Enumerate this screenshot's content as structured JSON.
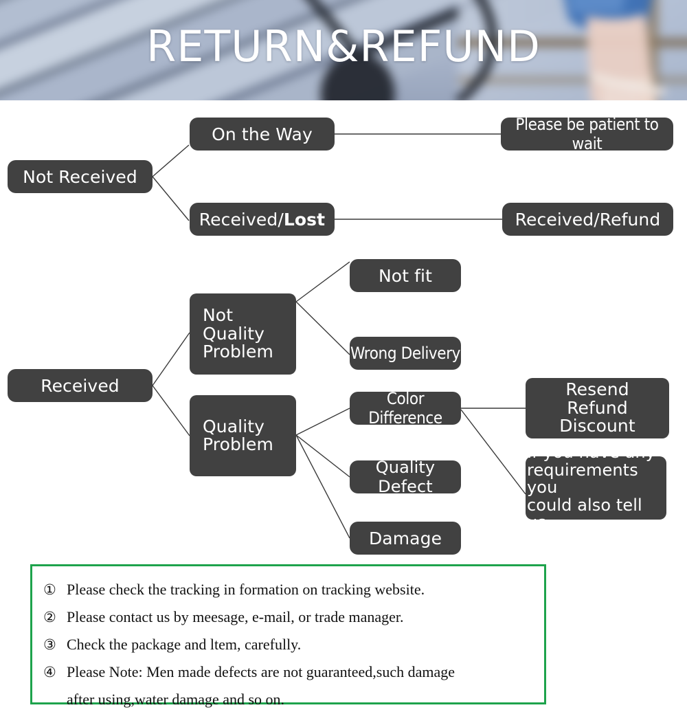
{
  "banner": {
    "title": "RETURN&REFUND",
    "scene": "blurred wooden deck with bicycle and person in denim shorts",
    "title_color": "#ffffff"
  },
  "theme": {
    "node_fill": "#414141",
    "node_text": "#ffffff",
    "line_color": "#3a3a3a",
    "note_border": "#1ea34c",
    "page_bg": "#ffffff"
  },
  "flowchart": {
    "nodes": {
      "not_received": "Not Received",
      "on_the_way": "On the Way",
      "received_lost_pre": "Received/",
      "received_lost_bold": "Lost",
      "please_wait": "Please be patient to wait",
      "received_refund": "Received/Refund",
      "received": "Received",
      "not_quality_problem": "Not\nQuality\nProblem",
      "quality_problem": "Quality\nProblem",
      "not_fit": "Not fit",
      "wrong_delivery": "Wrong Delivery",
      "color_difference": "Color Difference",
      "quality_defect": "Quality Defect",
      "damage": "Damage",
      "resend_refund_discount": "Resend\nRefund\nDiscount",
      "any_requirements": "If you have any\nrequirements you\ncould also tell us"
    }
  },
  "notes": {
    "items": [
      {
        "num": "①",
        "text": "Please check the tracking in formation on tracking website."
      },
      {
        "num": "②",
        "text": "Please contact us by meesage, e-mail, or trade manager."
      },
      {
        "num": "③",
        "text": "Check the package and ltem, carefully."
      },
      {
        "num": "④",
        "text": "Please Note: Men made defects  are not guaranteed,such damage"
      }
    ],
    "last_continuation": "after using,water damage and so on."
  }
}
